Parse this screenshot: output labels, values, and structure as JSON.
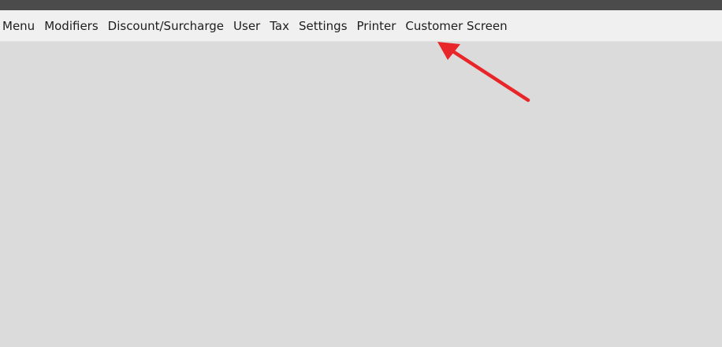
{
  "menubar": {
    "items": [
      {
        "label": "Menu"
      },
      {
        "label": "Modifiers"
      },
      {
        "label": "Discount/Surcharge"
      },
      {
        "label": "User"
      },
      {
        "label": "Tax"
      },
      {
        "label": "Settings"
      },
      {
        "label": "Printer"
      },
      {
        "label": "Customer Screen"
      }
    ]
  },
  "annotation": {
    "arrow_color": "#e8262a",
    "points_to": "Customer Screen"
  },
  "colors": {
    "title_strip": "#4b4b4b",
    "menubar_bg": "#f0f0f0",
    "content_bg": "#dbdbdb"
  }
}
